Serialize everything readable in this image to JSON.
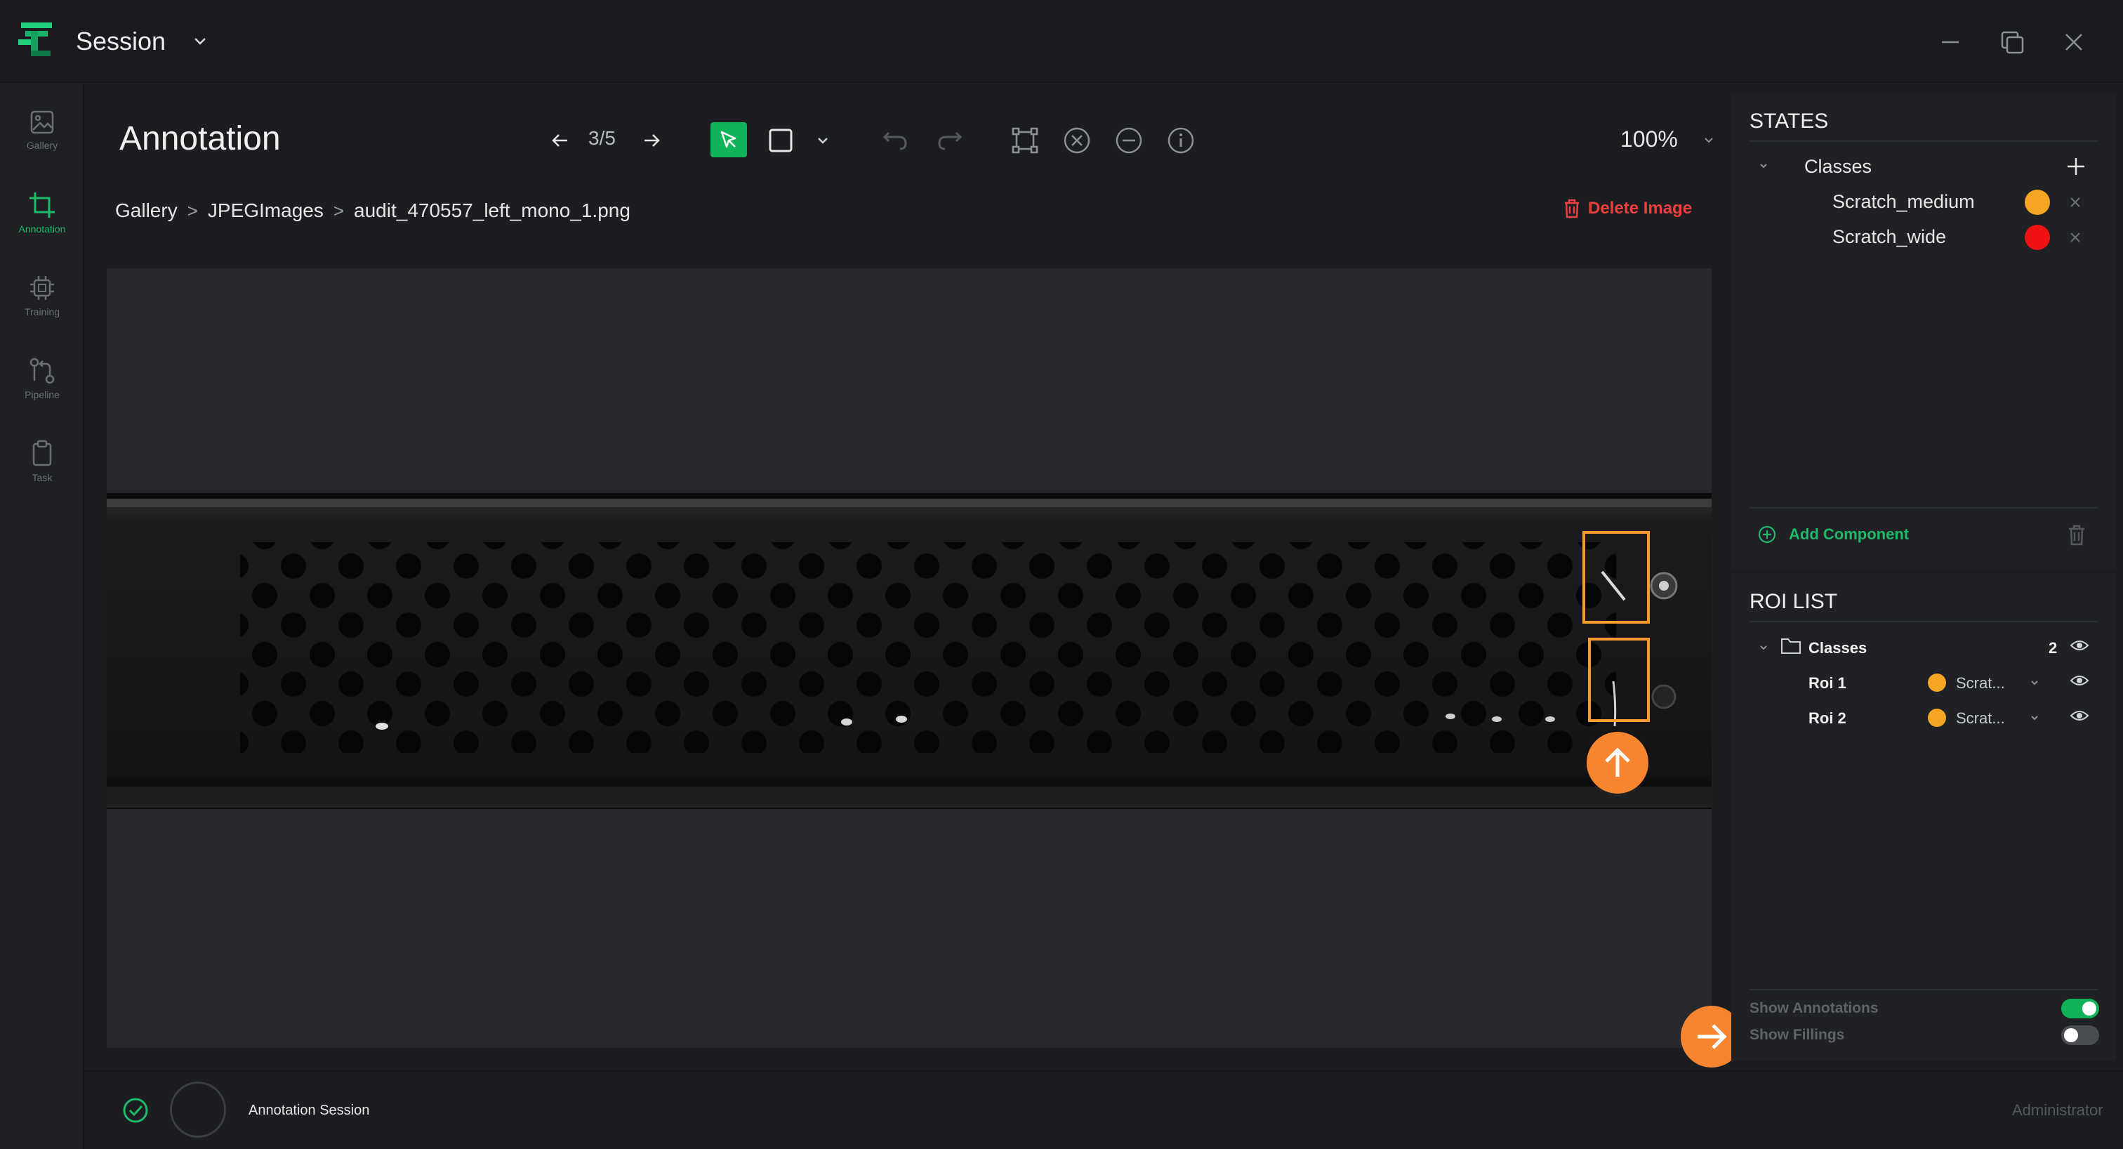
{
  "app": {
    "title": "Session"
  },
  "sidebar": {
    "items": [
      {
        "label": "Gallery",
        "icon": "image-icon"
      },
      {
        "label": "Annotation",
        "icon": "crop-icon",
        "active": true
      },
      {
        "label": "Training",
        "icon": "chip-icon"
      },
      {
        "label": "Pipeline",
        "icon": "pipeline-icon"
      },
      {
        "label": "Task",
        "icon": "clipboard-icon"
      }
    ]
  },
  "main": {
    "title": "Annotation",
    "breadcrumb": [
      "Gallery",
      "JPEGImages",
      "audit_470557_left_mono_1.png"
    ],
    "breadcrumb_separator": ">",
    "delete_label": "Delete Image"
  },
  "toolbar": {
    "page_counter": "3/5",
    "zoom": "100%"
  },
  "states": {
    "title": "STATES",
    "group_label": "Classes",
    "classes": [
      {
        "name": "Scratch_medium",
        "color": "#f5a623"
      },
      {
        "name": "Scratch_wide",
        "color": "#f01313"
      }
    ],
    "add_component_label": "Add Component"
  },
  "roi_list": {
    "title": "ROI LIST",
    "group_label": "Classes",
    "count": "2",
    "rois": [
      {
        "label": "Roi 1",
        "class": "Scrat...",
        "color": "#f5a623"
      },
      {
        "label": "Roi 2",
        "class": "Scrat...",
        "color": "#f5a623"
      }
    ],
    "show_annotations_label": "Show Annotations",
    "show_annotations_on": true,
    "show_fillings_label": "Show Fillings",
    "show_fillings_on": false
  },
  "status": {
    "session_label": "Annotation Session",
    "user_role": "Administrator"
  },
  "colors": {
    "accent": "#10b35a",
    "danger": "#ef3e3e",
    "roi": "#f59a2d",
    "hint": "#f7852f"
  }
}
